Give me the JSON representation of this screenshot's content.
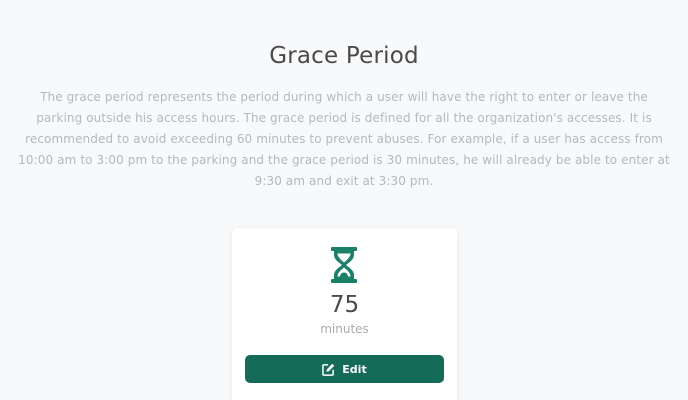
{
  "header": {
    "title": "Grace Period",
    "description": "The grace period represents the period during which a user will have the right to enter or leave the parking outside his access hours. The grace period is defined for all the organization's accesses. It is recommended to avoid exceeding 60 minutes to prevent abuses. For example, if a user has access from 10:00 am to 3:00 pm to the parking and the grace period is 30 minutes, he will already be able to enter at 9:30 am and exit at 3:30 pm."
  },
  "grace_card": {
    "icon": "hourglass-icon",
    "value": "75",
    "unit": "minutes",
    "edit_label": "Edit",
    "edit_icon": "edit-icon"
  },
  "colors": {
    "accent": "#136b58",
    "icon": "#1a8068",
    "background": "#f8f9fa"
  }
}
